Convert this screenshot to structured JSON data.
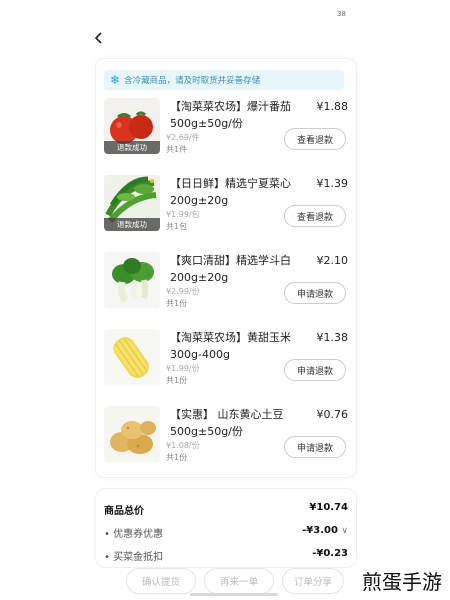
{
  "status_bar": {
    "indicator": "38"
  },
  "nav": {
    "back_icon": "chevron-left-icon"
  },
  "notice": {
    "icon": "snowflake-icon",
    "text": "含冷藏商品，请及时取货并妥善存储"
  },
  "items": [
    {
      "title": "【淘菜菜农场】爆汁番茄500g±50g/份",
      "price": "¥1.88",
      "unit_price": "¥2.69/件",
      "qty": "共1件",
      "badge": "退款成功",
      "action": "查看退款",
      "image": "tomato"
    },
    {
      "title": "【日日鲜】精选宁夏菜心200g±20g",
      "price": "¥1.39",
      "unit_price": "¥1.99/包",
      "qty": "共1包",
      "badge": "退款成功",
      "action": "查看退款",
      "image": "choy-sum"
    },
    {
      "title": "【爽口清甜】精选学斗白200g±20g",
      "price": "¥2.10",
      "unit_price": "¥2.99/份",
      "qty": "共1份",
      "badge": "",
      "action": "申请退款",
      "image": "bok-choy"
    },
    {
      "title": "【淘菜菜农场】黄甜玉米300g-400g",
      "price": "¥1.38",
      "unit_price": "¥1.99/份",
      "qty": "共1份",
      "badge": "",
      "action": "申请退款",
      "image": "corn"
    },
    {
      "title": "【实惠】 山东黄心土豆 500g±50g/份",
      "price": "¥0.76",
      "unit_price": "¥1.08/份",
      "qty": "共1份",
      "badge": "",
      "action": "申请退款",
      "image": "potato"
    }
  ],
  "summary": {
    "total_label": "商品总价",
    "total_value": "¥10.74",
    "coupon_label": "优惠券优惠",
    "coupon_value": "-¥3.00",
    "bonus_label": "买菜金抵扣",
    "bonus_value": "-¥0.23"
  },
  "bottom_bar": {
    "confirm": "确认提货",
    "reorder": "再来一单",
    "share": "订单分享"
  },
  "watermark": "煎蛋手游"
}
